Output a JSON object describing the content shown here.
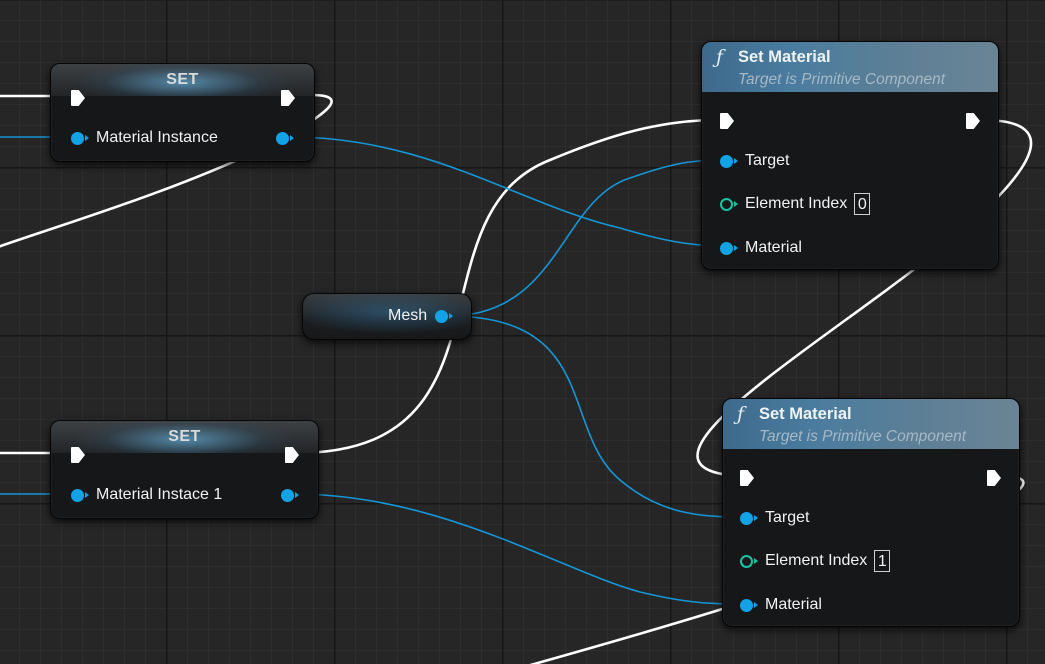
{
  "set_nodes": [
    {
      "title": "SET",
      "pin_label": "Material Instance"
    },
    {
      "title": "SET",
      "pin_label": "Material Instace 1"
    }
  ],
  "getter_node": {
    "label": "Mesh"
  },
  "function_nodes": [
    {
      "icon": "function-icon",
      "title": "Set Material",
      "subtitle": "Target is Primitive Component",
      "target_label": "Target",
      "element_index_label": "Element Index",
      "element_index_value": "0",
      "material_label": "Material"
    },
    {
      "icon": "function-icon",
      "title": "Set Material",
      "subtitle": "Target is Primitive Component",
      "target_label": "Target",
      "element_index_label": "Element Index",
      "element_index_value": "1",
      "material_label": "Material"
    }
  ],
  "colors": {
    "graph_background": "#262626",
    "exec_wire": "#ffffff",
    "object_pin": "#11a3e6",
    "integer_pin": "#19c4a4",
    "function_header": "#4a7c9f"
  },
  "glyphs": {
    "function": "ƒ"
  }
}
